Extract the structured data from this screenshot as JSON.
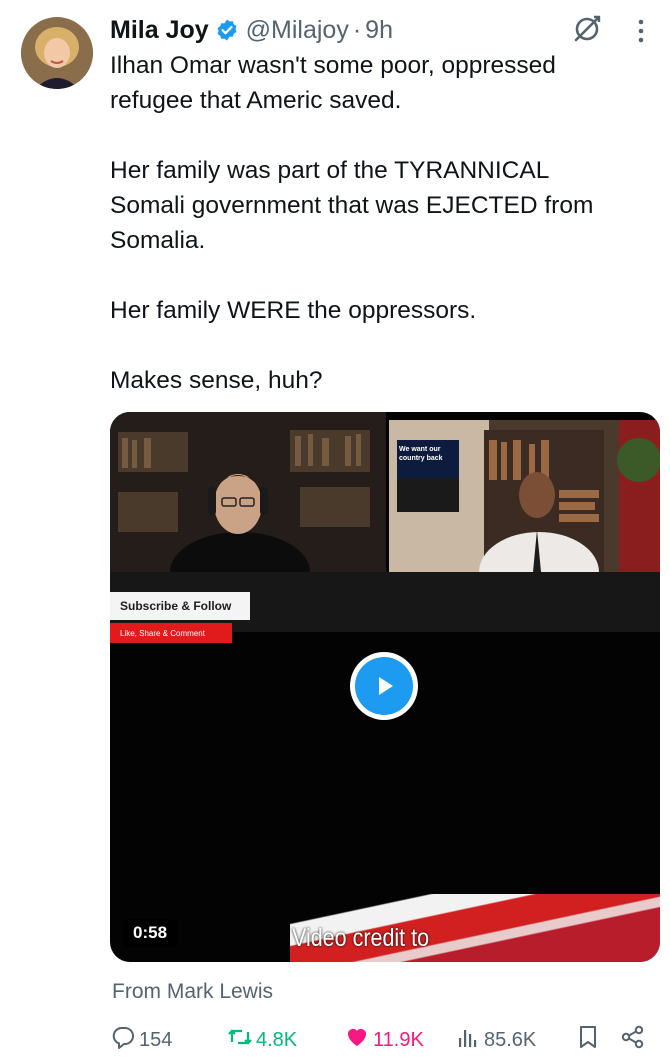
{
  "tweet": {
    "author_name": "Mila Joy",
    "handle": "@Milajoy",
    "separator": "·",
    "time": "9h",
    "body_lines": [
      "Ilhan Omar wasn't some poor, oppressed",
      "refugee that Americ saved.",
      "",
      "Her family was part of the TYRANNICAL",
      "Somali government that was EJECTED from",
      "Somalia.",
      "",
      "Her family WERE the oppressors.",
      "",
      "Makes sense, huh?"
    ],
    "attribution": "From Mark Lewis"
  },
  "video": {
    "subscribe_label": "Subscribe & Follow",
    "likeshare_label": "Like, Share & Comment",
    "sign_text": "We want our country back",
    "caption": "Video credit to",
    "duration": "0:58"
  },
  "actions": {
    "replies": "154",
    "reposts": "4.8K",
    "likes": "11.9K",
    "views": "85.6K"
  },
  "colors": {
    "verified": "#1d9bf0",
    "play": "#1d9bf0",
    "repost": "#00ba7c",
    "like": "#f91880",
    "muted": "#536471"
  },
  "icons": [
    "verified-badge-icon",
    "grok-icon",
    "more-icon",
    "play-icon",
    "reply-icon",
    "repost-icon",
    "like-icon",
    "views-icon",
    "bookmark-icon",
    "share-icon"
  ]
}
